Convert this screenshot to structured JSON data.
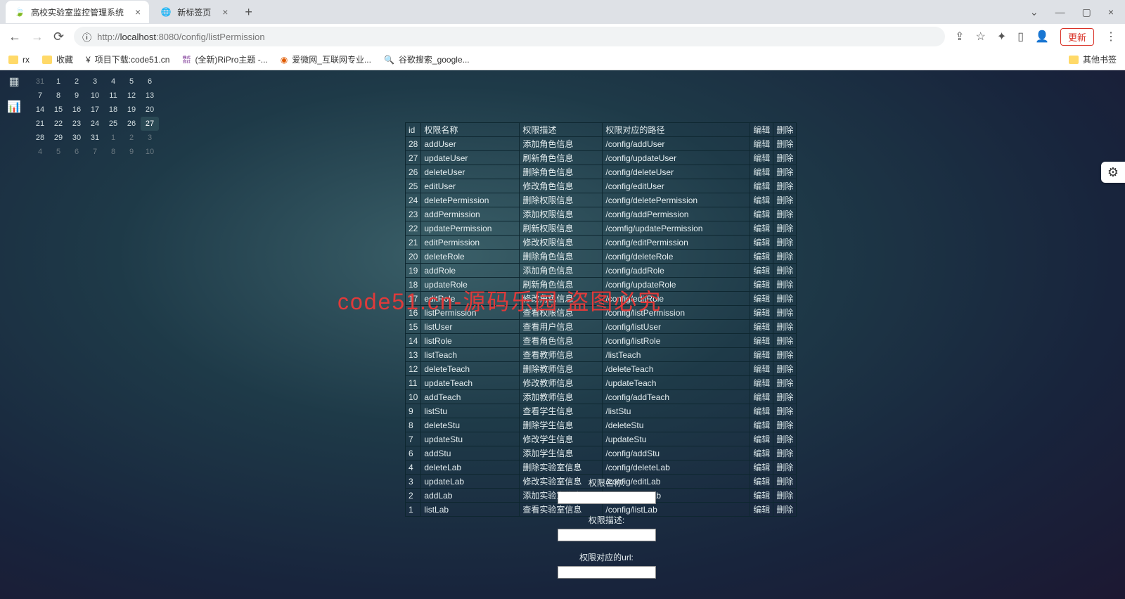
{
  "browser": {
    "tabs": [
      {
        "title": "高校实验室监控管理系统",
        "favicon": "leaf"
      },
      {
        "title": "新标签页",
        "favicon": "globe"
      }
    ],
    "url_host": "localhost",
    "url_port": ":8080",
    "url_path": "/config/listPermission",
    "url_scheme": "http://",
    "update_label": "更新"
  },
  "bookmarks": {
    "items": [
      "rx",
      "收藏",
      "项目下载:code51.cn",
      "(全新)RiPro主题 -...",
      "爱微网_互联网专业...",
      "谷歌搜索_google..."
    ],
    "other": "其他书签"
  },
  "calendar": {
    "weeks": [
      [
        {
          "d": "31",
          "muted": true
        },
        {
          "d": "1"
        },
        {
          "d": "2"
        },
        {
          "d": "3"
        },
        {
          "d": "4"
        },
        {
          "d": "5"
        },
        {
          "d": "6"
        }
      ],
      [
        {
          "d": "7"
        },
        {
          "d": "8"
        },
        {
          "d": "9"
        },
        {
          "d": "10"
        },
        {
          "d": "11"
        },
        {
          "d": "12"
        },
        {
          "d": "13"
        }
      ],
      [
        {
          "d": "14"
        },
        {
          "d": "15"
        },
        {
          "d": "16"
        },
        {
          "d": "17"
        },
        {
          "d": "18"
        },
        {
          "d": "19"
        },
        {
          "d": "20"
        }
      ],
      [
        {
          "d": "21"
        },
        {
          "d": "22"
        },
        {
          "d": "23"
        },
        {
          "d": "24"
        },
        {
          "d": "25"
        },
        {
          "d": "26"
        },
        {
          "d": "27",
          "active": true
        }
      ],
      [
        {
          "d": "28"
        },
        {
          "d": "29"
        },
        {
          "d": "30"
        },
        {
          "d": "31"
        },
        {
          "d": "1",
          "muted": true
        },
        {
          "d": "2",
          "muted": true
        },
        {
          "d": "3",
          "muted": true
        }
      ],
      [
        {
          "d": "4",
          "muted": true
        },
        {
          "d": "5",
          "muted": true
        },
        {
          "d": "6",
          "muted": true
        },
        {
          "d": "7",
          "muted": true
        },
        {
          "d": "8",
          "muted": true
        },
        {
          "d": "9",
          "muted": true
        },
        {
          "d": "10",
          "muted": true
        }
      ]
    ]
  },
  "table": {
    "headers": {
      "id": "id",
      "name": "权限名称",
      "desc": "权限描述",
      "path": "权限对应的路径",
      "edit": "编辑",
      "del": "删除"
    },
    "rows": [
      {
        "id": "28",
        "name": "addUser",
        "desc": "添加角色信息",
        "path": "/config/addUser"
      },
      {
        "id": "27",
        "name": "updateUser",
        "desc": "刷新角色信息",
        "path": "/config/updateUser"
      },
      {
        "id": "26",
        "name": "deleteUser",
        "desc": "删除角色信息",
        "path": "/config/deleteUser"
      },
      {
        "id": "25",
        "name": "editUser",
        "desc": "修改角色信息",
        "path": "/config/editUser"
      },
      {
        "id": "24",
        "name": "deletePermission",
        "desc": "删除权限信息",
        "path": "/config/deletePermission"
      },
      {
        "id": "23",
        "name": "addPermission",
        "desc": "添加权限信息",
        "path": "/config/addPermission"
      },
      {
        "id": "22",
        "name": "updatePermission",
        "desc": "刷新权限信息",
        "path": "/comfig/updatePermission"
      },
      {
        "id": "21",
        "name": "editPermission",
        "desc": "修改权限信息",
        "path": "/config/editPermission"
      },
      {
        "id": "20",
        "name": "deleteRole",
        "desc": "删除角色信息",
        "path": "/config/deleteRole"
      },
      {
        "id": "19",
        "name": "addRole",
        "desc": "添加角色信息",
        "path": "/config/addRole"
      },
      {
        "id": "18",
        "name": "updateRole",
        "desc": "刷新角色信息",
        "path": "/config/updateRole"
      },
      {
        "id": "17",
        "name": "editRole",
        "desc": "修改角色信息",
        "path": "/config/editRole"
      },
      {
        "id": "16",
        "name": "listPermission",
        "desc": "查看权限信息",
        "path": "/config/listPermission"
      },
      {
        "id": "15",
        "name": "listUser",
        "desc": "查看用户信息",
        "path": "/config/listUser"
      },
      {
        "id": "14",
        "name": "listRole",
        "desc": "查看角色信息",
        "path": "/config/listRole"
      },
      {
        "id": "13",
        "name": "listTeach",
        "desc": "查看教师信息",
        "path": "/listTeach"
      },
      {
        "id": "12",
        "name": "deleteTeach",
        "desc": "删除教师信息",
        "path": "/deleteTeach"
      },
      {
        "id": "11",
        "name": "updateTeach",
        "desc": "修改教师信息",
        "path": "/updateTeach"
      },
      {
        "id": "10",
        "name": "addTeach",
        "desc": "添加教师信息",
        "path": "/config/addTeach"
      },
      {
        "id": "9",
        "name": "listStu",
        "desc": "查看学生信息",
        "path": "/listStu"
      },
      {
        "id": "8",
        "name": "deleteStu",
        "desc": "删除学生信息",
        "path": "/deleteStu"
      },
      {
        "id": "7",
        "name": "updateStu",
        "desc": "修改学生信息",
        "path": "/updateStu"
      },
      {
        "id": "6",
        "name": "addStu",
        "desc": "添加学生信息",
        "path": "/config/addStu"
      },
      {
        "id": "4",
        "name": "deleteLab",
        "desc": "删除实验室信息",
        "path": "/config/deleteLab"
      },
      {
        "id": "3",
        "name": "updateLab",
        "desc": "修改实验室信息",
        "path": "/config/editLab"
      },
      {
        "id": "2",
        "name": "addLab",
        "desc": "添加实验室信息",
        "path": "/config/addLab"
      },
      {
        "id": "1",
        "name": "listLab",
        "desc": "查看实验室信息",
        "path": "/config/listLab"
      }
    ],
    "actions": {
      "edit": "编辑",
      "del": "删除"
    }
  },
  "form": {
    "name_label": "权限名称:",
    "desc_label": "权限描述:",
    "url_label": "权限对应的url:"
  },
  "watermark": "code51.cn-源码乐园 盗图必究"
}
